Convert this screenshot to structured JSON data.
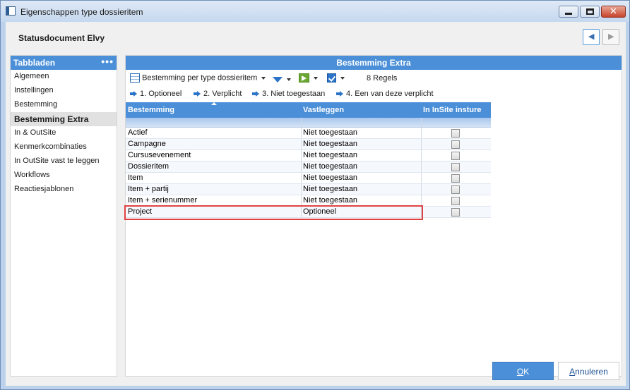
{
  "window": {
    "title": "Eigenschappen type dossieritem"
  },
  "header": {
    "document_title": "Statusdocument Elvy"
  },
  "sidebar": {
    "title": "Tabbladen",
    "more": "•••",
    "items": [
      {
        "label": "Algemeen"
      },
      {
        "label": "Instellingen"
      },
      {
        "label": "Bestemming"
      },
      {
        "label": "Bestemming Extra",
        "active": true
      },
      {
        "label": "In & OutSite"
      },
      {
        "label": "Kenmerkcombinaties"
      },
      {
        "label": "In OutSite vast te leggen"
      },
      {
        "label": "Workflows"
      },
      {
        "label": "Reactiesjablonen"
      }
    ]
  },
  "main": {
    "title": "Bestemming Extra",
    "toolbar": {
      "view_label": "Bestemming per type dossieritem",
      "count_label": "8 Regels"
    },
    "legend": [
      {
        "label": "1. Optioneel"
      },
      {
        "label": "2. Verplicht"
      },
      {
        "label": "3. Niet toegestaan"
      },
      {
        "label": "4. Een van deze verplicht"
      }
    ],
    "table": {
      "columns": [
        "Bestemming",
        "Vastleggen",
        "In InSite insture"
      ],
      "rows": [
        {
          "bestemming": "Actief",
          "vastleggen": "Niet toegestaan",
          "insite": false
        },
        {
          "bestemming": "Campagne",
          "vastleggen": "Niet toegestaan",
          "insite": false
        },
        {
          "bestemming": "Cursusevenement",
          "vastleggen": "Niet toegestaan",
          "insite": false
        },
        {
          "bestemming": "Dossieritem",
          "vastleggen": "Niet toegestaan",
          "insite": false
        },
        {
          "bestemming": "Item",
          "vastleggen": "Niet toegestaan",
          "insite": false
        },
        {
          "bestemming": "Item + partij",
          "vastleggen": "Niet toegestaan",
          "insite": false
        },
        {
          "bestemming": "Item + serienummer",
          "vastleggen": "Niet toegestaan",
          "insite": false
        },
        {
          "bestemming": "Project",
          "vastleggen": "Optioneel",
          "insite": false
        }
      ]
    }
  },
  "footer": {
    "ok_label": "OK",
    "cancel_label": "Annuleren"
  },
  "colors": {
    "accent": "#4a8fd8",
    "highlight": "#e04343"
  }
}
